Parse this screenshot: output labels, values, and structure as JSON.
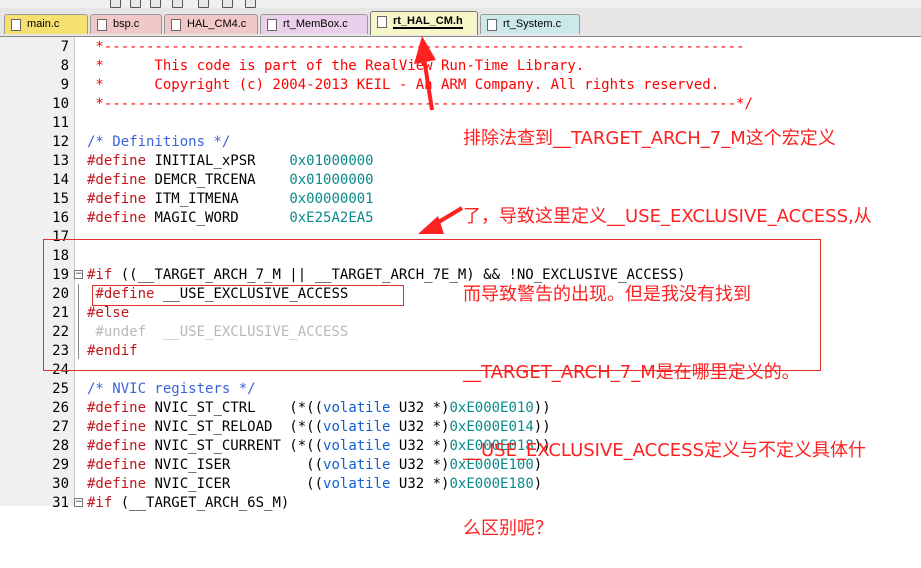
{
  "tabs": [
    {
      "label": "main.c",
      "color": "#f5e070"
    },
    {
      "label": "bsp.c",
      "color": "#f0c8c8"
    },
    {
      "label": "HAL_CM4.c",
      "color": "#f0c8c8"
    },
    {
      "label": "rt_MemBox.c",
      "color": "#ead0ea"
    },
    {
      "label": "rt_HAL_CM.h",
      "color": "#f6f6c8",
      "active": true
    },
    {
      "label": "rt_System.c",
      "color": "#cce8e8"
    }
  ],
  "lines": [
    {
      "n": "7",
      "segs": [
        {
          "c": "cm",
          "t": " *----------------------------------------------------------------------------"
        }
      ]
    },
    {
      "n": "8",
      "segs": [
        {
          "c": "cm",
          "t": " *      This code is part of the RealView Run-Time Library."
        }
      ]
    },
    {
      "n": "9",
      "segs": [
        {
          "c": "cm",
          "t": " *      Copyright (c) 2004-2013 KEIL - An ARM Company. All rights reserved."
        }
      ]
    },
    {
      "n": "10",
      "segs": [
        {
          "c": "cm",
          "t": " *---------------------------------------------------------------------------*/"
        }
      ]
    },
    {
      "n": "11",
      "segs": []
    },
    {
      "n": "12",
      "segs": [
        {
          "c": "cmb",
          "t": "/* Definitions */"
        }
      ]
    },
    {
      "n": "13",
      "segs": [
        {
          "c": "pp",
          "t": "#define"
        },
        {
          "c": "",
          "t": " INITIAL_xPSR    "
        },
        {
          "c": "num",
          "t": "0x01000000"
        }
      ]
    },
    {
      "n": "14",
      "segs": [
        {
          "c": "pp",
          "t": "#define"
        },
        {
          "c": "",
          "t": " DEMCR_TRCENA    "
        },
        {
          "c": "num",
          "t": "0x01000000"
        }
      ]
    },
    {
      "n": "15",
      "segs": [
        {
          "c": "pp",
          "t": "#define"
        },
        {
          "c": "",
          "t": " ITM_ITMENA      "
        },
        {
          "c": "num",
          "t": "0x00000001"
        }
      ]
    },
    {
      "n": "16",
      "segs": [
        {
          "c": "pp",
          "t": "#define"
        },
        {
          "c": "",
          "t": " MAGIC_WORD      "
        },
        {
          "c": "num",
          "t": "0xE25A2EA5"
        }
      ]
    },
    {
      "n": "17",
      "segs": []
    },
    {
      "n": "18",
      "segs": []
    },
    {
      "n": "19",
      "fold": "minus",
      "segs": [
        {
          "c": "pp",
          "t": "#if"
        },
        {
          "c": "",
          "t": " ((__TARGET_ARCH_7_M || __TARGET_ARCH_7E_M) && !NO_EXCLUSIVE_ACCESS)"
        }
      ]
    },
    {
      "n": "20",
      "segs": [
        {
          "c": "pp",
          "t": " #define"
        },
        {
          "c": "",
          "t": " __USE_EXCLUSIVE_ACCESS"
        }
      ]
    },
    {
      "n": "21",
      "segs": [
        {
          "c": "pp",
          "t": "#else"
        }
      ]
    },
    {
      "n": "22",
      "segs": [
        {
          "c": "grey",
          "t": " #undef  __USE_EXCLUSIVE_ACCESS"
        }
      ]
    },
    {
      "n": "23",
      "segs": [
        {
          "c": "pp",
          "t": "#endif"
        }
      ]
    },
    {
      "n": "24",
      "segs": []
    },
    {
      "n": "25",
      "segs": [
        {
          "c": "cmb",
          "t": "/* NVIC registers */"
        }
      ]
    },
    {
      "n": "26",
      "segs": [
        {
          "c": "pp",
          "t": "#define"
        },
        {
          "c": "",
          "t": " NVIC_ST_CTRL    (*(("
        },
        {
          "c": "kw",
          "t": "volatile"
        },
        {
          "c": "",
          "t": " U32 *)"
        },
        {
          "c": "num",
          "t": "0xE000E010"
        },
        {
          "c": "",
          "t": "))"
        }
      ]
    },
    {
      "n": "27",
      "segs": [
        {
          "c": "pp",
          "t": "#define"
        },
        {
          "c": "",
          "t": " NVIC_ST_RELOAD  (*(("
        },
        {
          "c": "kw",
          "t": "volatile"
        },
        {
          "c": "",
          "t": " U32 *)"
        },
        {
          "c": "num",
          "t": "0xE000E014"
        },
        {
          "c": "",
          "t": "))"
        }
      ]
    },
    {
      "n": "28",
      "segs": [
        {
          "c": "pp",
          "t": "#define"
        },
        {
          "c": "",
          "t": " NVIC_ST_CURRENT (*(("
        },
        {
          "c": "kw",
          "t": "volatile"
        },
        {
          "c": "",
          "t": " U32 *)"
        },
        {
          "c": "num",
          "t": "0xE000E018"
        },
        {
          "c": "",
          "t": "))"
        }
      ]
    },
    {
      "n": "29",
      "segs": [
        {
          "c": "pp",
          "t": "#define"
        },
        {
          "c": "",
          "t": " NVIC_ISER         (("
        },
        {
          "c": "kw",
          "t": "volatile"
        },
        {
          "c": "",
          "t": " U32 *)"
        },
        {
          "c": "num",
          "t": "0xE000E100"
        },
        {
          "c": "",
          "t": ")"
        }
      ]
    },
    {
      "n": "30",
      "segs": [
        {
          "c": "pp",
          "t": "#define"
        },
        {
          "c": "",
          "t": " NVIC_ICER         (("
        },
        {
          "c": "kw",
          "t": "volatile"
        },
        {
          "c": "",
          "t": " U32 *)"
        },
        {
          "c": "num",
          "t": "0xE000E180"
        },
        {
          "c": "",
          "t": ")"
        }
      ]
    },
    {
      "n": "31",
      "fold": "minus",
      "segs": [
        {
          "c": "pp",
          "t": "#if"
        },
        {
          "c": "",
          "t": " (__TARGET_ARCH_6S_M)"
        }
      ]
    }
  ],
  "annotation": {
    "lines": [
      "排除法查到__TARGET_ARCH_7_M这个宏定义",
      "了，导致这里定义__USE_EXCLUSIVE_ACCESS,从",
      "而导致警告的出现。但是我没有找到",
      "__TARGET_ARCH_7_M是在哪里定义的。",
      "__USE_EXCLUSIVE_ACCESS定义与不定义具体什",
      "么区别呢？"
    ],
    "color": "#ff2020"
  }
}
